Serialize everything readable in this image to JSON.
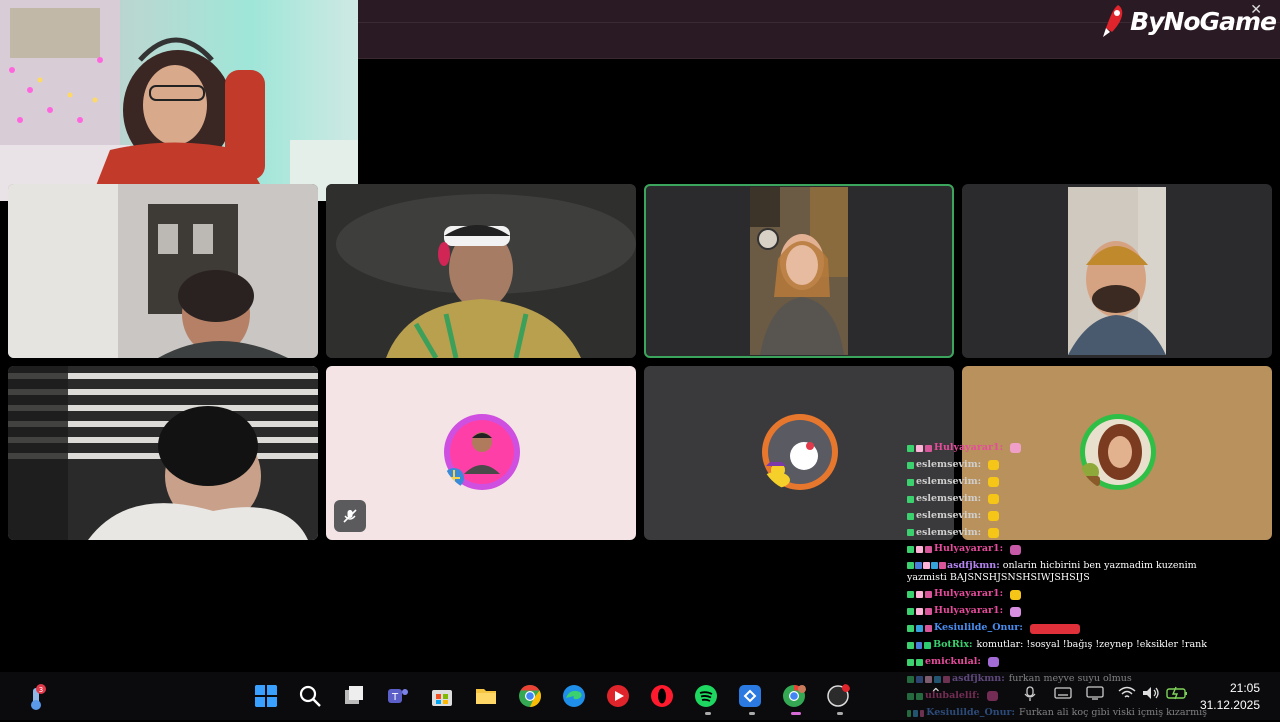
{
  "logo": {
    "text": "ByNoGame"
  },
  "chat": {
    "messages": [
      {
        "user": "Hulyayarar1:",
        "color": "#e64b9c",
        "text": "",
        "emote": "#f0a0c8",
        "badges": [
          "#3bd16f",
          "#ffb3d9",
          "#d9559a"
        ]
      },
      {
        "user": "eslemsevim:",
        "color": "#cfcfcf",
        "text": "",
        "emote": "#f5c518",
        "badges": [
          "#3bd16f"
        ]
      },
      {
        "user": "eslemsevim:",
        "color": "#cfcfcf",
        "text": "",
        "emote": "#f5c518",
        "badges": [
          "#3bd16f"
        ]
      },
      {
        "user": "eslemsevim:",
        "color": "#cfcfcf",
        "text": "",
        "emote": "#f5c518",
        "badges": [
          "#3bd16f"
        ]
      },
      {
        "user": "eslemsevim:",
        "color": "#cfcfcf",
        "text": "",
        "emote": "#f5c518",
        "badges": [
          "#3bd16f"
        ]
      },
      {
        "user": "eslemsevim:",
        "color": "#cfcfcf",
        "text": "",
        "emote": "#f5c518",
        "badges": [
          "#3bd16f"
        ]
      },
      {
        "user": "Hulyayarar1:",
        "color": "#e64b9c",
        "text": "",
        "emote": "#c75aa8",
        "badges": [
          "#3bd16f",
          "#ffb3d9",
          "#d9559a"
        ]
      },
      {
        "user": "asdfjkmn:",
        "color": "#b686f2",
        "text": "onlarin hicbirini ben yazmadim kuzenim yazmisti BAJSNSHJSNSHSIWJSHSIJS",
        "emote": "",
        "badges": [
          "#3bd16f",
          "#4a7fd9",
          "#ffb3d9",
          "#35a3d9",
          "#d9559a"
        ],
        "wrap": true
      },
      {
        "user": "Hulyayarar1:",
        "color": "#e64b9c",
        "text": "",
        "emote": "#f5c518",
        "badges": [
          "#3bd16f",
          "#ffb3d9",
          "#d9559a"
        ]
      },
      {
        "user": "Hulyayarar1:",
        "color": "#e64b9c",
        "text": "",
        "emote": "#d98fe0",
        "badges": [
          "#3bd16f",
          "#ffb3d9",
          "#d9559a"
        ]
      },
      {
        "user": "Kesiulilde_Onur:",
        "color": "#4a8df0",
        "text": "",
        "emote": "#e0303a",
        "badges": [
          "#3bd16f",
          "#35a3d9",
          "#d9559a"
        ],
        "wide": true
      },
      {
        "user": "BotRix:",
        "color": "#3bd16f",
        "text": "komutlar: !sosyal !bağış !zeynep !eksikler !rank",
        "emote": "",
        "badges": [
          "#3bd16f",
          "#4a7fd9",
          "#2ecc71"
        ]
      },
      {
        "user": "emickulal:",
        "color": "#e64b9c",
        "text": "",
        "emote": "#a26bd6",
        "badges": [
          "#3bd16f",
          "#3bd16f"
        ]
      },
      {
        "user": "asdfjkmn:",
        "color": "#b686f2",
        "text": "furkan meyve suyu olmus",
        "emote": "",
        "badges": [
          "#3bd16f",
          "#4a7fd9",
          "#ffb3d9",
          "#35a3d9",
          "#d9559a"
        ]
      },
      {
        "user": "ulubalelif:",
        "color": "#e64b9c",
        "text": "",
        "emote": "#e64b9c",
        "badges": [
          "#3bd16f",
          "#3bd16f"
        ]
      },
      {
        "user": "Kesiulilde_Onur:",
        "color": "#4a8df0",
        "text": "Furkan ali koç gibi viski içmiş kızarmış",
        "emote": "",
        "badges": [
          "#3bd16f",
          "#35a3d9",
          "#d9559a"
        ]
      }
    ]
  },
  "taskbar": {
    "weather_badge": "3",
    "clock_time": "21:05",
    "clock_date": "31.12.2025",
    "apps": [
      "windows-start",
      "search",
      "task-view",
      "teams",
      "microsoft-store",
      "file-explorer",
      "chrome",
      "edge",
      "media-player",
      "opera",
      "spotify",
      "nearby-share",
      "chrome-profile",
      "obs-studio"
    ]
  }
}
